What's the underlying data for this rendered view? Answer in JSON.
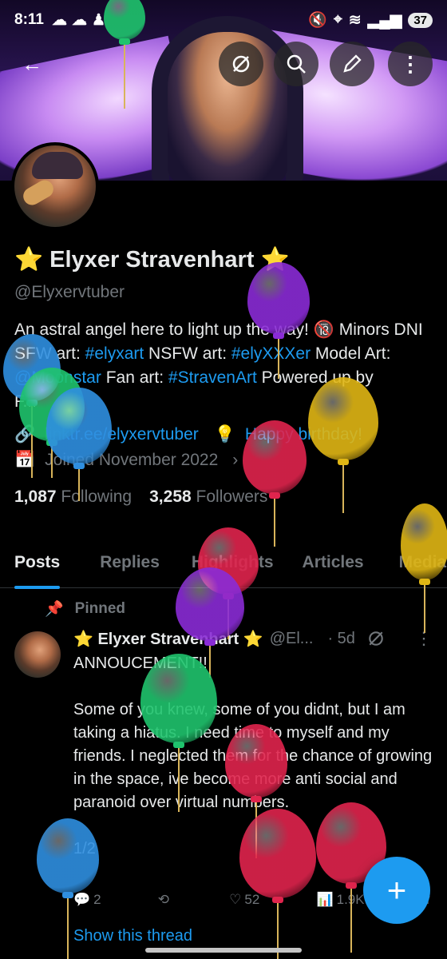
{
  "status_bar": {
    "time": "8:11",
    "battery": "37",
    "left_icons": [
      "weather-icon",
      "cloud-icon",
      "figure-icon"
    ],
    "right_icons": [
      "mute-icon",
      "location-icon",
      "wifi-icon",
      "signal-icon"
    ]
  },
  "top_bar": {
    "back_icon": "←",
    "buttons": [
      "grok-icon",
      "search-icon",
      "edit-icon",
      "more-icon"
    ]
  },
  "profile": {
    "display_name": "⭐ Elyxer Stravenhart ⭐",
    "handle": "@Elyxervtuber",
    "bio_parts": {
      "p1": "An astral angel here to light up the way! 🔞 Minors DNI SFW art: ",
      "sfw_tag": "#elyxart",
      "p2": "  NSFW art: ",
      "nsfw_tag": "#elyXXXer",
      "p3": " Model Art: ",
      "art_tag": "@Moonstar",
      "p4": " Fan art: ",
      "fan_tag": "#StravenArt",
      "p5": "  Powered up by ",
      "p6": "F..."
    },
    "link": "linktr.ee/elyxervtuber",
    "birthday": "Happy birthday!",
    "joined": "Joined November 2022",
    "following_count": "1,087",
    "following_label": "Following",
    "followers_count": "3,258",
    "followers_label": "Followers"
  },
  "tabs": [
    {
      "label": "Posts",
      "active": true
    },
    {
      "label": "Replies",
      "active": false
    },
    {
      "label": "Highlights",
      "active": false
    },
    {
      "label": "Articles",
      "active": false
    },
    {
      "label": "Media",
      "active": false
    }
  ],
  "post": {
    "pinned_label": "Pinned",
    "author": "⭐ Elyxer Stravenhart ⭐",
    "handle": "@El...",
    "time": "· 5d",
    "body": "ANNOUCEMENT!!\n\nSome of you knew, some of you didnt, but I am taking a hiatus. I need time to myself and my friends. I neglected them for the chance of growing in the space, ive become more anti social and paranoid over virtual numbers.\n\n1/2",
    "replies": "2",
    "reposts": "",
    "likes": "52",
    "views": "1.9K",
    "show_thread": "Show this thread"
  },
  "fab_label": "+",
  "colors": {
    "accent": "#1d9bf0",
    "background": "#000000",
    "text": "#e7e9ea",
    "muted": "#71767b",
    "balloon_blue": "#2f8fe0",
    "balloon_green": "#1fc46d",
    "balloon_purple": "#8a2bd6",
    "balloon_red": "#e0244d",
    "balloon_yellow": "#e0b614"
  }
}
